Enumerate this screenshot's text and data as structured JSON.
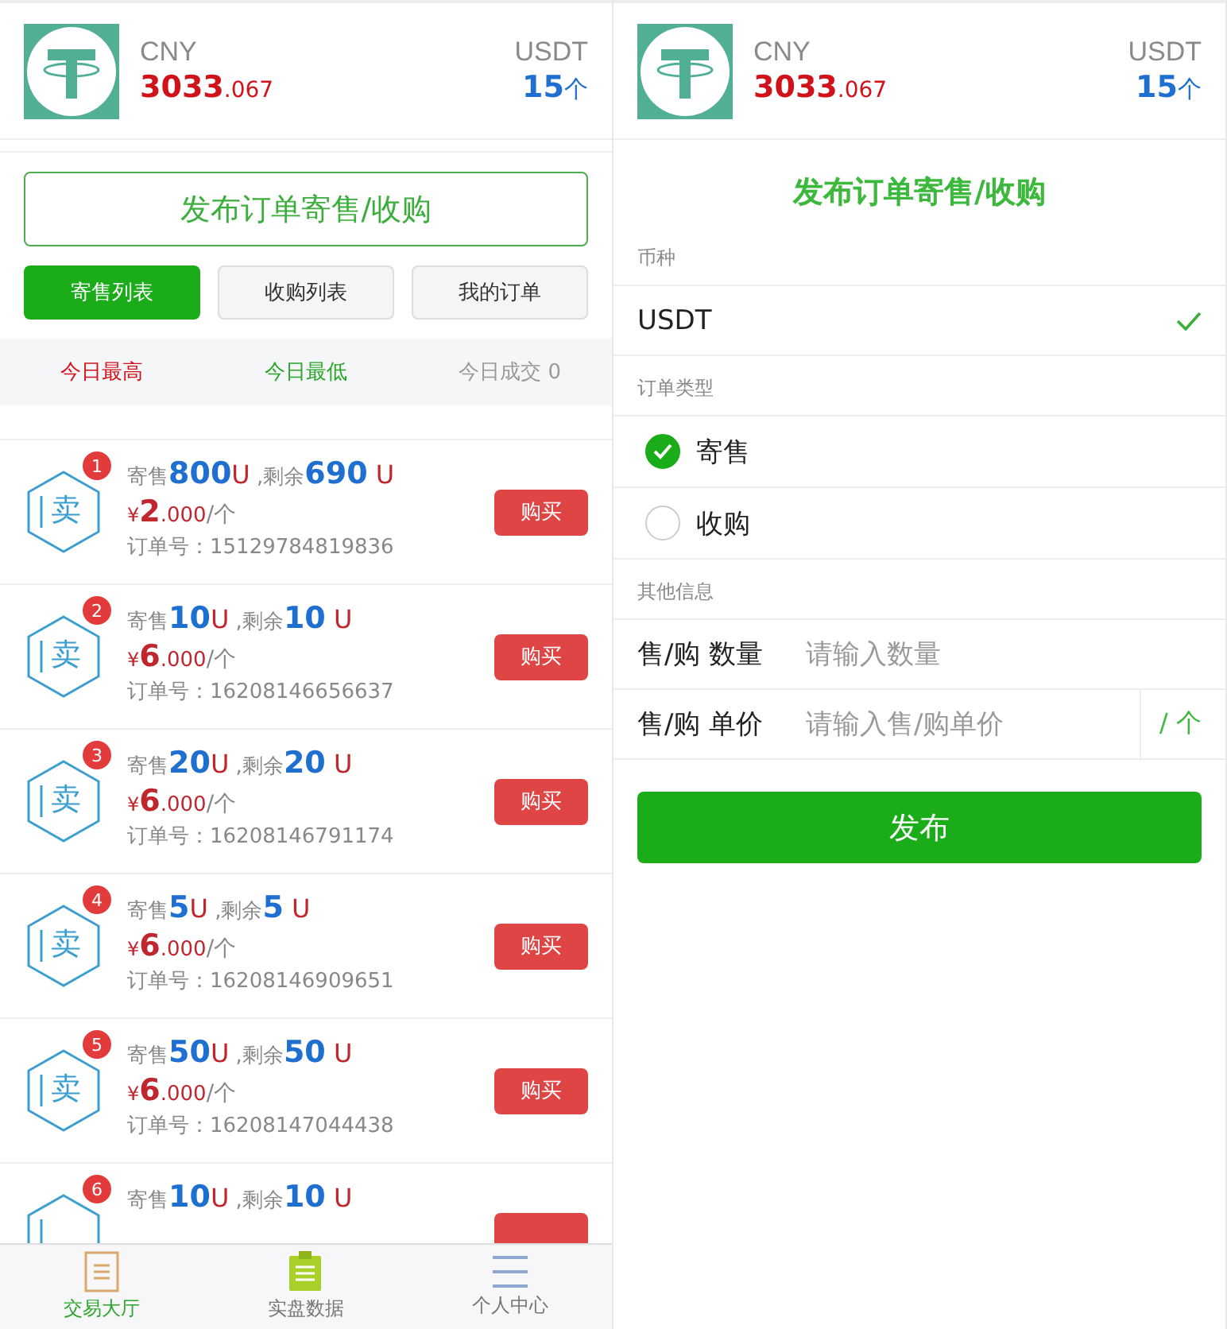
{
  "screens": [
    {
      "header": {
        "currency": "CNY",
        "balance_int": "3033",
        "balance_dec": ".067",
        "asset": "USDT",
        "asset_amount": "15",
        "asset_unit": "个"
      },
      "publish_button": "发布订单寄售/收购",
      "tabs": [
        {
          "label": "寄售列表",
          "selected": true
        },
        {
          "label": "收购列表",
          "selected": false
        },
        {
          "label": "我的订单",
          "selected": false
        }
      ],
      "stats": [
        {
          "label": "今日最高",
          "color": "#d0121b"
        },
        {
          "label": "今日最低",
          "color": "#2aa52a"
        },
        {
          "label": "今日成交 0",
          "color": "#999999"
        }
      ],
      "orders": [
        {
          "index": "1",
          "icon_text": "卖",
          "sell_label": "寄售",
          "sell_amount": "800",
          "sell_unit": "U",
          "remain_label": " ,剩余",
          "remain_amount": "690",
          "remain_unit": " U",
          "price_symbol": "¥",
          "price_int": "2",
          "price_dec": ".000",
          "price_unit": "/个",
          "order_no": "订单号：15129784819836",
          "buy": "购买"
        },
        {
          "index": "2",
          "icon_text": "卖",
          "sell_label": "寄售",
          "sell_amount": "10",
          "sell_unit": "U",
          "remain_label": " ,剩余",
          "remain_amount": "10",
          "remain_unit": " U",
          "price_symbol": "¥",
          "price_int": "6",
          "price_dec": ".000",
          "price_unit": "/个",
          "order_no": "订单号：16208146656637",
          "buy": "购买"
        },
        {
          "index": "3",
          "icon_text": "卖",
          "sell_label": "寄售",
          "sell_amount": "20",
          "sell_unit": "U",
          "remain_label": " ,剩余",
          "remain_amount": "20",
          "remain_unit": " U",
          "price_symbol": "¥",
          "price_int": "6",
          "price_dec": ".000",
          "price_unit": "/个",
          "order_no": "订单号：16208146791174",
          "buy": "购买"
        },
        {
          "index": "4",
          "icon_text": "卖",
          "sell_label": "寄售",
          "sell_amount": "5",
          "sell_unit": "U",
          "remain_label": " ,剩余",
          "remain_amount": "5",
          "remain_unit": " U",
          "price_symbol": "¥",
          "price_int": "6",
          "price_dec": ".000",
          "price_unit": "/个",
          "order_no": "订单号：16208146909651",
          "buy": "购买"
        },
        {
          "index": "5",
          "icon_text": "卖",
          "sell_label": "寄售",
          "sell_amount": "50",
          "sell_unit": "U",
          "remain_label": " ,剩余",
          "remain_amount": "50",
          "remain_unit": " U",
          "price_symbol": "¥",
          "price_int": "6",
          "price_dec": ".000",
          "price_unit": "/个",
          "order_no": "订单号：16208147044438",
          "buy": "购买"
        },
        {
          "index": "6",
          "sell_label": "寄售",
          "sell_amount": "10",
          "sell_unit": "U",
          "remain_label": " ,剩余",
          "remain_amount": "10",
          "remain_unit": " U"
        }
      ],
      "nav": [
        {
          "label": "交易大厅",
          "kind": "document",
          "selected": true
        },
        {
          "label": "实盘数据",
          "kind": "clipboard",
          "selected": false
        },
        {
          "label": "个人中心",
          "kind": "menu",
          "selected": false
        }
      ]
    },
    {
      "header": {
        "currency": "CNY",
        "balance_int": "3033",
        "balance_dec": ".067",
        "asset": "USDT",
        "asset_amount": "15",
        "asset_unit": "个"
      },
      "form": {
        "title": "发布订单寄售/收购",
        "sections": [
          {
            "label": "币种",
            "kind": "select",
            "options": [
              {
                "label": "USDT",
                "checked": true
              }
            ]
          },
          {
            "label": "订单类型",
            "kind": "radio",
            "options": [
              {
                "label": "寄售",
                "selected": true
              },
              {
                "label": "收购",
                "selected": false
              }
            ]
          },
          {
            "label": "其他信息",
            "kind": "inputs",
            "fields": [
              {
                "label": "售/购 数量",
                "placeholder": "请输入数量"
              },
              {
                "label": "售/购 单价",
                "placeholder": "请输入售/购单价",
                "suffix": "/ 个"
              }
            ]
          }
        ],
        "submit": "发布"
      }
    }
  ]
}
